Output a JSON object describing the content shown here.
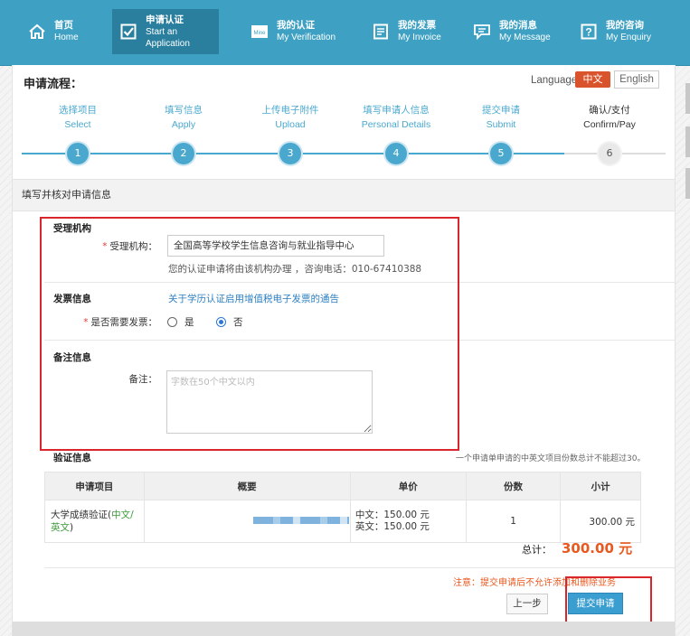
{
  "nav": {
    "items": [
      {
        "cn": "首页",
        "en": "Home",
        "icon": "home-icon"
      },
      {
        "cn": "申请认证",
        "en": "Start an Application",
        "icon": "checkbox-icon"
      },
      {
        "cn": "我的认证",
        "en": "My Verification",
        "icon": "verification-icon",
        "badge": "Mine"
      },
      {
        "cn": "我的发票",
        "en": "My Invoice",
        "icon": "invoice-icon"
      },
      {
        "cn": "我的消息",
        "en": "My Message",
        "icon": "message-icon"
      },
      {
        "cn": "我的咨询",
        "en": "My Enquiry",
        "icon": "enquiry-icon"
      }
    ],
    "active_index": 1
  },
  "process": {
    "title": "申请流程：",
    "language_label": "Language：",
    "lang_cn": "中文",
    "lang_en": "English",
    "steps": [
      {
        "cn": "选择项目",
        "en": "Select",
        "num": "1"
      },
      {
        "cn": "填写信息",
        "en": "Apply",
        "num": "2"
      },
      {
        "cn": "上传电子附件",
        "en": "Upload",
        "num": "3"
      },
      {
        "cn": "填写申请人信息",
        "en": "Personal Details",
        "num": "4"
      },
      {
        "cn": "提交申请",
        "en": "Submit",
        "num": "5"
      },
      {
        "cn": "确认/支付",
        "en": "Confirm/Pay",
        "num": "6"
      }
    ]
  },
  "form": {
    "section_title": "填写并核对申请信息",
    "institution": {
      "group_title": "受理机构",
      "label": "受理机构：",
      "value": "全国高等学校学生信息咨询与就业指导中心",
      "helper": "您的认证申请将由该机构办理 ，咨询电话：010-67410388"
    },
    "invoice": {
      "group_title": "发票信息",
      "notice_link": "关于学历认证启用增值税电子发票的通告",
      "label": "是否需要发票：",
      "option_yes": "是",
      "option_no": "否",
      "selected": "否"
    },
    "remark": {
      "group_title": "备注信息",
      "label": "备注：",
      "placeholder": "字数在50个中文以内"
    }
  },
  "verification": {
    "title": "验证信息",
    "limit_note": "一个申请单申请的中英文项目份数总计不能超过30。",
    "columns": [
      "申请项目",
      "概要",
      "单价",
      "份数",
      "小计"
    ],
    "rows": [
      {
        "item_prefix": "大学成绩验证(",
        "item_green": "中文/英文",
        "item_suffix": ")",
        "price_cn": "中文：150.00 元",
        "price_en": "英文：150.00 元",
        "quantity": "1",
        "subtotal": "300.00 元"
      }
    ],
    "total_label": "总计：",
    "total_value": "300.00 元"
  },
  "footer": {
    "warning": "注意：提交申请后不允许添加和删除业务",
    "prev_button": "上一步",
    "submit_button": "提交申请"
  },
  "colors": {
    "nav_bg": "#3ea0c2",
    "nav_active": "#2a7f9f",
    "step_blue": "#4aa8cf",
    "lang_active": "#d9542c",
    "highlight_red": "#d9262c",
    "total_orange": "#e8581f",
    "submit_blue": "#3a9ed0"
  }
}
